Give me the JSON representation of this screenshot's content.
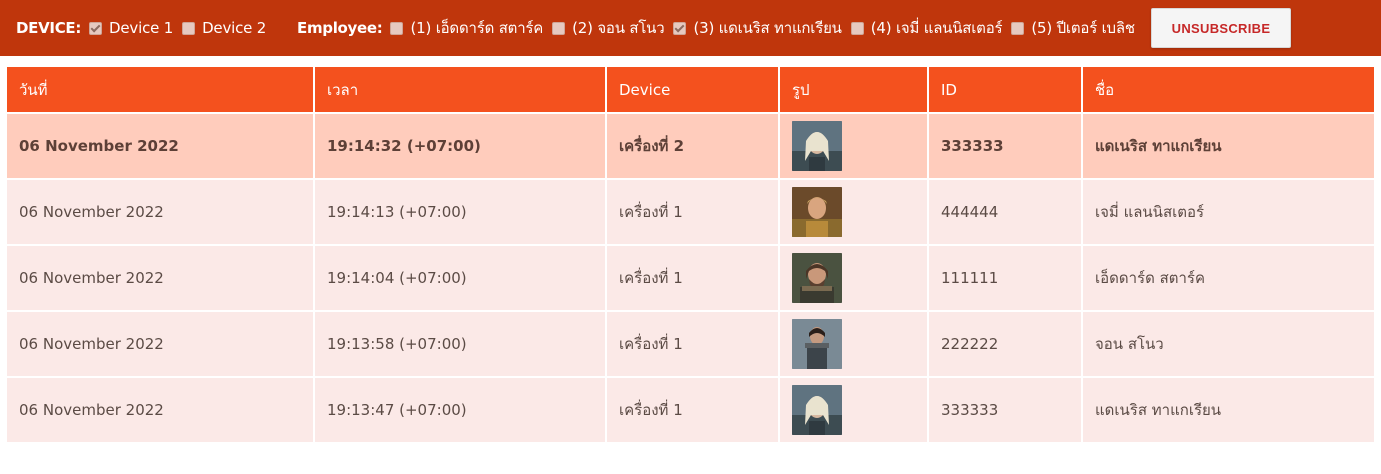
{
  "header": {
    "device_label": "DEVICE:",
    "devices": [
      {
        "label": "Device 1",
        "checked": true
      },
      {
        "label": "Device 2",
        "checked": false
      }
    ],
    "employee_label": "Employee:",
    "employees": [
      {
        "label": "(1) เอ็ดดาร์ด สตาร์ค",
        "checked": false
      },
      {
        "label": "(2) จอน สโนว",
        "checked": false
      },
      {
        "label": "(3) แดเนริส ทาแกเรียน",
        "checked": true
      },
      {
        "label": "(4) เจมี่ แลนนิสเตอร์",
        "checked": false
      },
      {
        "label": "(5) ปีเตอร์ เบลิช",
        "checked": false
      }
    ],
    "unsubscribe_label": "UNSUBSCRIBE"
  },
  "table": {
    "columns": [
      "วันที่",
      "เวลา",
      "Device",
      "รูป",
      "ID",
      "ชื่อ"
    ],
    "rows": [
      {
        "date": "06 November 2022",
        "time": "19:14:32 (+07:00)",
        "device": "เครื่องที่ 2",
        "photo": "daenerys-photo",
        "id": "333333",
        "name": "แดเนริส ทาแกเรียน",
        "highlight": true
      },
      {
        "date": "06 November 2022",
        "time": "19:14:13 (+07:00)",
        "device": "เครื่องที่ 1",
        "photo": "jaime-photo",
        "id": "444444",
        "name": "เจมี่ แลนนิสเตอร์",
        "highlight": false
      },
      {
        "date": "06 November 2022",
        "time": "19:14:04 (+07:00)",
        "device": "เครื่องที่ 1",
        "photo": "eddard-photo",
        "id": "111111",
        "name": "เอ็ดดาร์ด สตาร์ค",
        "highlight": false
      },
      {
        "date": "06 November 2022",
        "time": "19:13:58 (+07:00)",
        "device": "เครื่องที่ 1",
        "photo": "jon-photo",
        "id": "222222",
        "name": "จอน สโนว",
        "highlight": false
      },
      {
        "date": "06 November 2022",
        "time": "19:13:47 (+07:00)",
        "device": "เครื่องที่ 1",
        "photo": "daenerys-photo",
        "id": "333333",
        "name": "แดเนริส ทาแกเรียน",
        "highlight": false
      }
    ]
  },
  "colors": {
    "topbar": "#bf360c",
    "header_row": "#f4511e",
    "row_bg": "#fbe9e7",
    "row_highlight": "#ffccbc",
    "unsubscribe_text": "#c62828"
  }
}
